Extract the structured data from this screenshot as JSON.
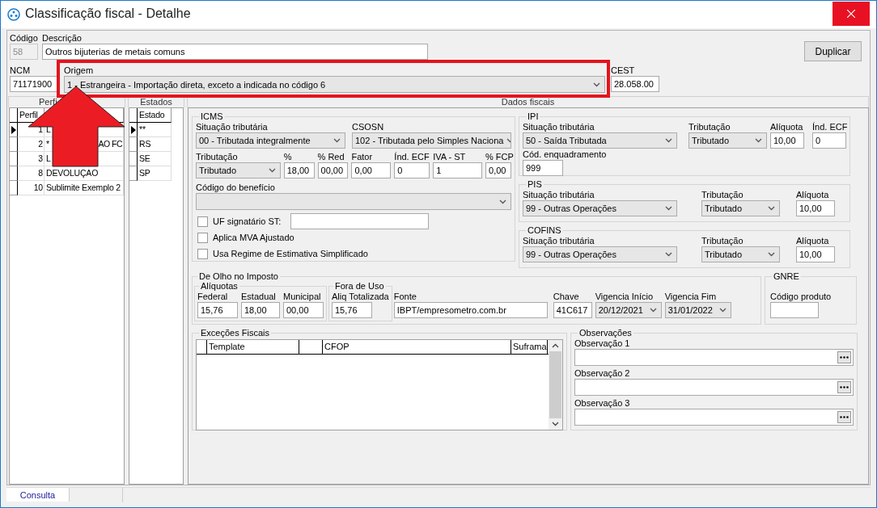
{
  "window": {
    "title": "Classificação fiscal - Detalhe"
  },
  "header": {
    "code": {
      "label": "Código",
      "value": "58",
      "kind": "text",
      "disabled": true
    },
    "description": {
      "label": "Descrição",
      "value": "Outros bijuterias de metais comuns",
      "kind": "text"
    },
    "ncm": {
      "label": "NCM",
      "value": "71171900",
      "kind": "text"
    },
    "origin": {
      "label": "Origem",
      "value": "1 - Estrangeira - Importação direta, exceto a indicada no código 6",
      "kind": "select"
    },
    "cest": {
      "label": "CEST",
      "value": "28.058.00",
      "kind": "text"
    },
    "duplicate_button": "Duplicar"
  },
  "profiles": {
    "title": "Perfi",
    "column": "Perfil",
    "rows": [
      {
        "selected": true,
        "perfil": "1",
        "description": "L"
      },
      {
        "selected": false,
        "perfil": "2",
        "description": "*",
        "description_end": "AO FC"
      },
      {
        "selected": false,
        "perfil": "3",
        "description": "L"
      },
      {
        "selected": false,
        "perfil": "8",
        "description": "DEVOLUÇAO"
      },
      {
        "selected": false,
        "perfil": "10",
        "description": "Sublimite Exemplo 2"
      }
    ]
  },
  "states": {
    "title": "Estados",
    "column": "Estado",
    "rows": [
      {
        "selected": true,
        "value": "**"
      },
      {
        "selected": false,
        "value": "RS"
      },
      {
        "selected": false,
        "value": "SE"
      },
      {
        "selected": false,
        "value": "SP"
      }
    ]
  },
  "fiscal": {
    "title": "Dados fiscais",
    "icms": {
      "title": "ICMS",
      "situacao": {
        "label": "Situação tributária",
        "value": "00 - Tributada integralmente",
        "kind": "select"
      },
      "csosn": {
        "label": "CSOSN",
        "value": "102 - Tributada pelo Simples Naciona",
        "kind": "select"
      },
      "rows": [
        [
          {
            "label": "Tributação",
            "value": "Tributado",
            "kind": "select"
          },
          {
            "label": "%",
            "value": "18,00",
            "kind": "text"
          },
          {
            "label": "% Red",
            "value": "00,00",
            "kind": "text"
          },
          {
            "label": "Fator",
            "value": "0,00",
            "kind": "text"
          },
          {
            "label": "Índ. ECF",
            "value": "0",
            "kind": "text"
          },
          {
            "label": "IVA - ST",
            "value": "1",
            "kind": "text"
          },
          {
            "label": "% FCP",
            "value": "0,00",
            "kind": "text"
          }
        ],
        [
          {
            "label": "Código do benefício",
            "kind": "select"
          }
        ]
      ],
      "checks": [
        {
          "label": "UF signatário ST:",
          "checked": false,
          "kind": "with_field"
        },
        {
          "label": "Aplica MVA Ajustado",
          "checked": false,
          "kind": "plain"
        },
        {
          "label": "Usa Regime de Estimativa Simplificado",
          "checked": false,
          "kind": "plain"
        }
      ]
    },
    "ipi": {
      "title": "IPI",
      "rows": [
        [
          {
            "label": "Situação tributária",
            "value": "50 - Saída Tributada",
            "kind": "select"
          },
          {
            "label": "Tributação",
            "value": "Tributado",
            "kind": "select"
          },
          {
            "label": "Alíquota",
            "value": "10,00",
            "kind": "text"
          },
          {
            "label": "Índ. ECF",
            "value": "0",
            "kind": "text"
          }
        ],
        [
          {
            "label": "Cód. enquadramento",
            "value": "999",
            "kind": "text"
          }
        ]
      ]
    },
    "pis": {
      "title": "PIS",
      "rows": [
        [
          {
            "label": "Situação tributária",
            "value": "99 - Outras Operações",
            "kind": "select"
          },
          {
            "label": "Tributação",
            "value": "Tributado",
            "kind": "select"
          },
          {
            "label": "Alíquota",
            "value": "10,00",
            "kind": "text"
          }
        ]
      ]
    },
    "cofins": {
      "title": "COFINS",
      "rows": [
        [
          {
            "label": "Situação tributária",
            "value": "99 - Outras Operações",
            "kind": "select"
          },
          {
            "label": "Tributação",
            "value": "Tributado",
            "kind": "select"
          },
          {
            "label": "Alíquota",
            "value": "10,00",
            "kind": "text"
          }
        ]
      ]
    },
    "olho": {
      "title": "De Olho no Imposto",
      "aliquotas": {
        "title": "Alíquotas",
        "fields": [
          {
            "label": "Federal",
            "value": "15,76",
            "kind": "text"
          },
          {
            "label": "Estadual",
            "value": "18,00",
            "kind": "text"
          },
          {
            "label": "Municipal",
            "value": "00,00",
            "kind": "text"
          }
        ]
      },
      "fora_de_uso": {
        "title": "Fora de Uso",
        "fields": [
          {
            "label": "Aliq Totalizada",
            "value": "15,76",
            "kind": "text"
          }
        ]
      },
      "fields": [
        {
          "label": "Fonte",
          "value": "IBPT/empresometro.com.br",
          "kind": "text"
        },
        {
          "label": "Chave",
          "value": "41C617",
          "kind": "text"
        },
        {
          "label": "Vigencia Início",
          "value": "20/12/2021",
          "kind": "select"
        },
        {
          "label": "Vigencia Fim",
          "value": "31/01/2022",
          "kind": "select"
        }
      ]
    },
    "gnre": {
      "title": "GNRE",
      "fields": [
        {
          "label": "Código produto",
          "kind": "text"
        }
      ]
    },
    "exceptions": {
      "title": "Exceções Fiscais",
      "columns": [
        "Template",
        "CFOP",
        "Suframa"
      ]
    },
    "observations": {
      "title": "Observações",
      "fields": [
        {
          "label": "Observação 1",
          "kind": "browse"
        },
        {
          "label": "Observação 2",
          "kind": "browse"
        },
        {
          "label": "Observação 3",
          "kind": "browse"
        }
      ]
    }
  },
  "status_tabs": [
    {
      "label": "Consulta",
      "selected": true
    }
  ]
}
